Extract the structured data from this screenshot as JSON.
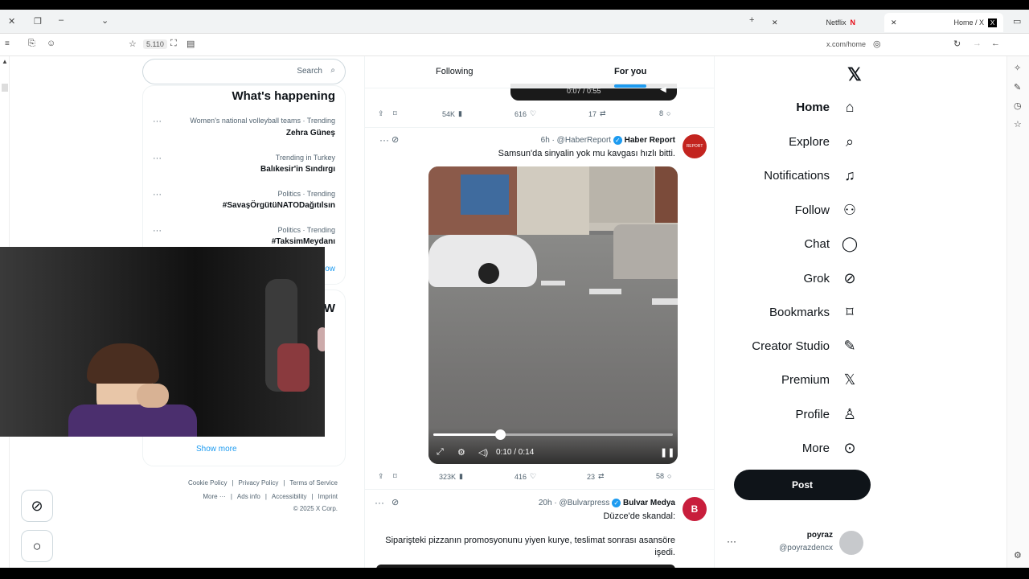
{
  "browser": {
    "tabs": [
      {
        "label": "Home / X",
        "active": true
      },
      {
        "label": "Netflix",
        "active": false
      }
    ],
    "url": "x.com/home",
    "toolbar_count": "5.110"
  },
  "nav": {
    "items": [
      {
        "label": "Home",
        "icon": "home-icon"
      },
      {
        "label": "Explore",
        "icon": "search-icon"
      },
      {
        "label": "Notifications",
        "icon": "bell-icon"
      },
      {
        "label": "Follow",
        "icon": "add-user-icon"
      },
      {
        "label": "Chat",
        "icon": "chat-icon"
      },
      {
        "label": "Grok",
        "icon": "grok-icon"
      },
      {
        "label": "Bookmarks",
        "icon": "bookmark-icon"
      },
      {
        "label": "Creator Studio",
        "icon": "creator-icon"
      },
      {
        "label": "Premium",
        "icon": "x-logo-icon"
      },
      {
        "label": "Profile",
        "icon": "profile-icon"
      },
      {
        "label": "More",
        "icon": "more-icon"
      }
    ],
    "post_label": "Post",
    "account": {
      "name": "poyraz",
      "handle": "@poyrazdencx"
    }
  },
  "feed": {
    "tabs": [
      "For you",
      "Following"
    ],
    "prev_post": {
      "video_time": "0:07 / 0:55",
      "replies": "8",
      "reposts": "17",
      "likes": "616",
      "views": "54K"
    },
    "post1": {
      "name": "Haber Report",
      "handle": "@HaberReport",
      "age": "6h",
      "text": "Samsun'da sinyalin yok mu kavgası hızlı bitti.",
      "avatar_label": "REPORT",
      "video_time": "0:10 / 0:14",
      "video_progress": 0.28,
      "replies": "58",
      "reposts": "23",
      "likes": "416",
      "views": "323K"
    },
    "post2": {
      "name": "Bulvar Medya",
      "handle": "@Bulvarpress",
      "age": "20h",
      "text1": "Düzce'de skandal:",
      "text2": "Siparişteki pizzanın promosyonunu yiyen kurye, teslimat sonrası asansöre işedi."
    }
  },
  "sidebar": {
    "search_placeholder": "Search",
    "trends_title": "What's happening",
    "trends": [
      {
        "meta": "Women's national volleyball teams · Trending",
        "name": "Zehra Güneş"
      },
      {
        "meta": "Trending in Turkey",
        "name": "Balıkesir'in Sındırgı"
      },
      {
        "meta": "Politics · Trending",
        "name": "#SavaşÖrgütüNATODağıtılsın"
      },
      {
        "meta": "Politics · Trending",
        "name": "#TaksimMeydanı"
      }
    ],
    "show_more": "Show",
    "who_title": "W",
    "who_show_more": "Show more",
    "footer": {
      "line1": [
        "Terms of Service",
        "Privacy Policy",
        "Cookie Policy"
      ],
      "line2": [
        "Imprint",
        "Accessibility",
        "Ads info",
        "More ···"
      ],
      "copyright": "© 2025 X Corp."
    }
  }
}
